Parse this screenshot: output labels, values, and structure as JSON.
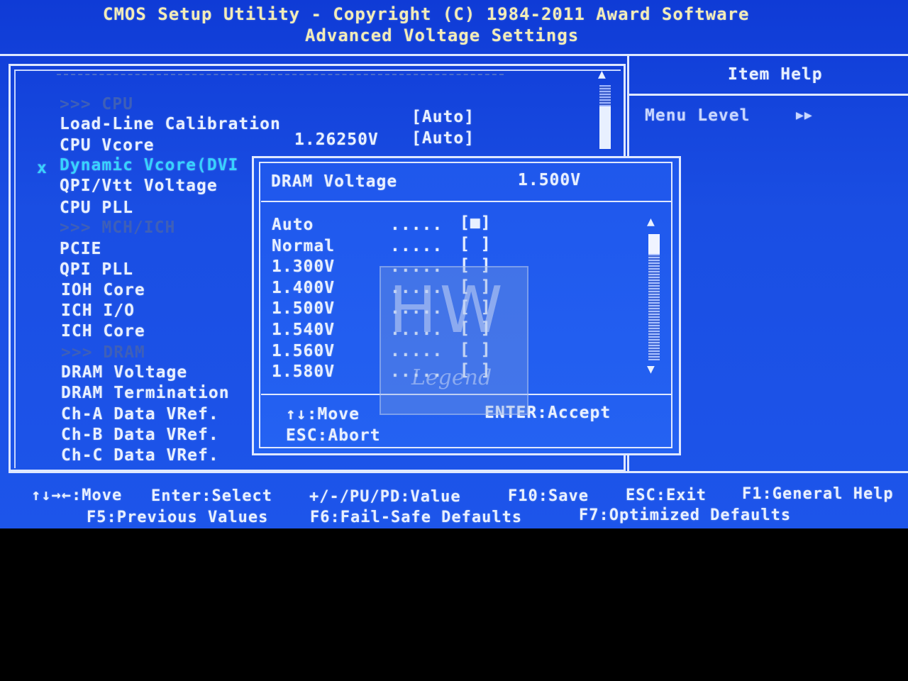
{
  "header": {
    "line1": "CMOS Setup Utility - Copyright (C) 1984-2011 Award Software",
    "line2": "Advanced Voltage Settings"
  },
  "menu": {
    "sections": {
      "cpu": ">>> CPU",
      "mch": ">>> MCH/ICH",
      "dram": ">>> DRAM"
    },
    "items": {
      "llc_label": "Load-Line Calibration",
      "llc_value": "[Auto]",
      "vcore_label": "CPU Vcore",
      "vcore_reading": "1.26250V",
      "vcore_value": "[Auto]",
      "dvid_marker": "x",
      "dvid_label": "Dynamic Vcore(DVI",
      "qpi_vtt_label": "QPI/Vtt Voltage",
      "cpu_pll_label": "CPU PLL",
      "pcie_label": "PCIE",
      "qpi_pll_label": "QPI PLL",
      "ioh_core_label": "IOH Core",
      "ich_io_label": "ICH I/O",
      "ich_core_label": "ICH Core",
      "dram_voltage_label": "DRAM Voltage",
      "dram_termination_label": "DRAM Termination",
      "cha_vref_label": "Ch-A Data VRef.",
      "chb_vref_label": "Ch-B Data VRef.",
      "chc_vref_label": "Ch-C Data VRef."
    }
  },
  "help": {
    "title": "Item Help",
    "menu_level_label": "Menu Level",
    "menu_level_arrows": "▶▶"
  },
  "popup": {
    "title": "DRAM Voltage",
    "current": "1.500V",
    "dots": ".....",
    "options": [
      {
        "label": "Auto",
        "mark": "[■]"
      },
      {
        "label": "Normal",
        "mark": "[ ]"
      },
      {
        "label": "1.300V",
        "mark": "[ ]"
      },
      {
        "label": "1.400V",
        "mark": "[ ]"
      },
      {
        "label": "1.500V",
        "mark": "[ ]"
      },
      {
        "label": "1.540V",
        "mark": "[ ]"
      },
      {
        "label": "1.560V",
        "mark": "[ ]"
      },
      {
        "label": "1.580V",
        "mark": "[ ]"
      }
    ],
    "key_move": "↑↓:Move",
    "key_accept": "ENTER:Accept",
    "key_abort": "ESC:Abort"
  },
  "watermark": {
    "big": "HW",
    "small": "Legend"
  },
  "footer": {
    "move": "↑↓→←:Move",
    "select": "Enter:Select",
    "value": "+/-/PU/PD:Value",
    "save": "F10:Save",
    "exit": "ESC:Exit",
    "general_help": "F1:General Help",
    "previous": "F5:Previous Values",
    "failsafe": "F6:Fail-Safe Defaults",
    "optimized": "F7:Optimized Defaults"
  },
  "colors": {
    "background": "#1a4ee3",
    "text": "#e8f0ff",
    "highlight": "#36d4ff",
    "title": "#f2ecb8"
  }
}
